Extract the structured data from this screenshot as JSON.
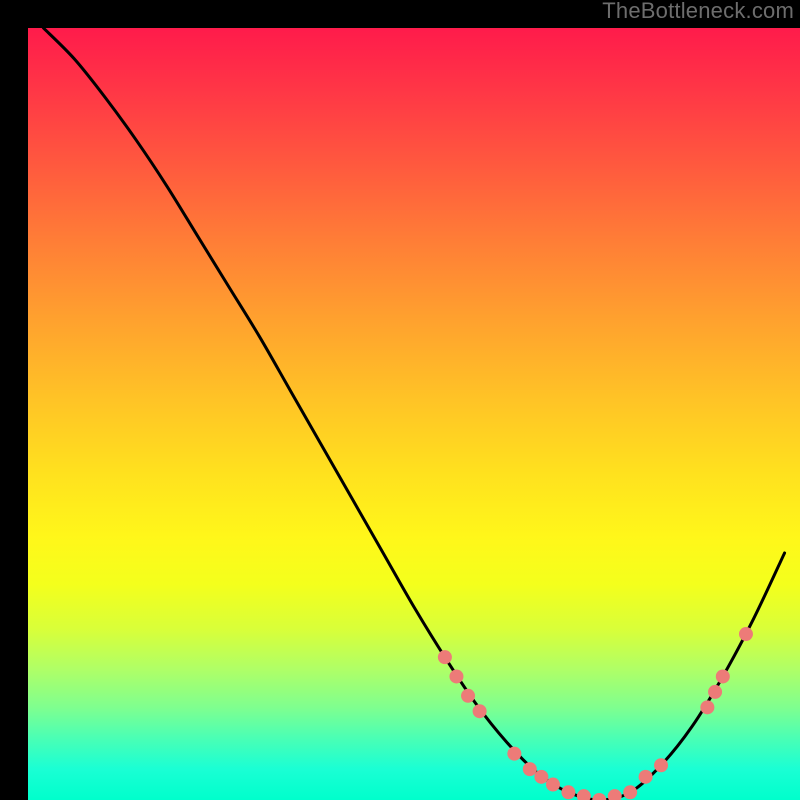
{
  "watermark": "TheBottleneck.com",
  "chart_data": {
    "type": "line",
    "title": "",
    "xlabel": "",
    "ylabel": "",
    "xlim": [
      0,
      100
    ],
    "ylim": [
      0,
      100
    ],
    "grid": false,
    "series": [
      {
        "name": "curve",
        "x": [
          2,
          6,
          10,
          14,
          18,
          22,
          26,
          30,
          34,
          38,
          42,
          46,
          50,
          54,
          58,
          62,
          66,
          70,
          74,
          78,
          82,
          86,
          90,
          94,
          98
        ],
        "y": [
          100,
          96,
          91,
          85.5,
          79.5,
          73,
          66.5,
          60,
          53,
          46,
          39,
          32,
          25,
          18.5,
          12.5,
          7.5,
          3.5,
          1,
          0,
          1,
          4.5,
          9.5,
          16,
          23.5,
          32
        ],
        "color": "#000000"
      }
    ],
    "markers": [
      {
        "x": 54,
        "y": 18.5
      },
      {
        "x": 55.5,
        "y": 16
      },
      {
        "x": 57,
        "y": 13.5
      },
      {
        "x": 58.5,
        "y": 11.5
      },
      {
        "x": 63,
        "y": 6
      },
      {
        "x": 65,
        "y": 4
      },
      {
        "x": 66.5,
        "y": 3
      },
      {
        "x": 68,
        "y": 2
      },
      {
        "x": 70,
        "y": 1
      },
      {
        "x": 72,
        "y": 0.5
      },
      {
        "x": 74,
        "y": 0
      },
      {
        "x": 76,
        "y": 0.5
      },
      {
        "x": 78,
        "y": 1
      },
      {
        "x": 80,
        "y": 3
      },
      {
        "x": 82,
        "y": 4.5
      },
      {
        "x": 88,
        "y": 12
      },
      {
        "x": 89,
        "y": 14
      },
      {
        "x": 90,
        "y": 16
      },
      {
        "x": 93,
        "y": 21.5
      }
    ],
    "marker_color": "#ed7b78",
    "gradient_stops": [
      {
        "pos": 0,
        "color": "#ff1b4b"
      },
      {
        "pos": 18,
        "color": "#ff5a3e"
      },
      {
        "pos": 38,
        "color": "#ffa22e"
      },
      {
        "pos": 58,
        "color": "#ffe21e"
      },
      {
        "pos": 78,
        "color": "#d8ff3a"
      },
      {
        "pos": 92,
        "color": "#4affb5"
      },
      {
        "pos": 100,
        "color": "#00ffcc"
      }
    ]
  }
}
